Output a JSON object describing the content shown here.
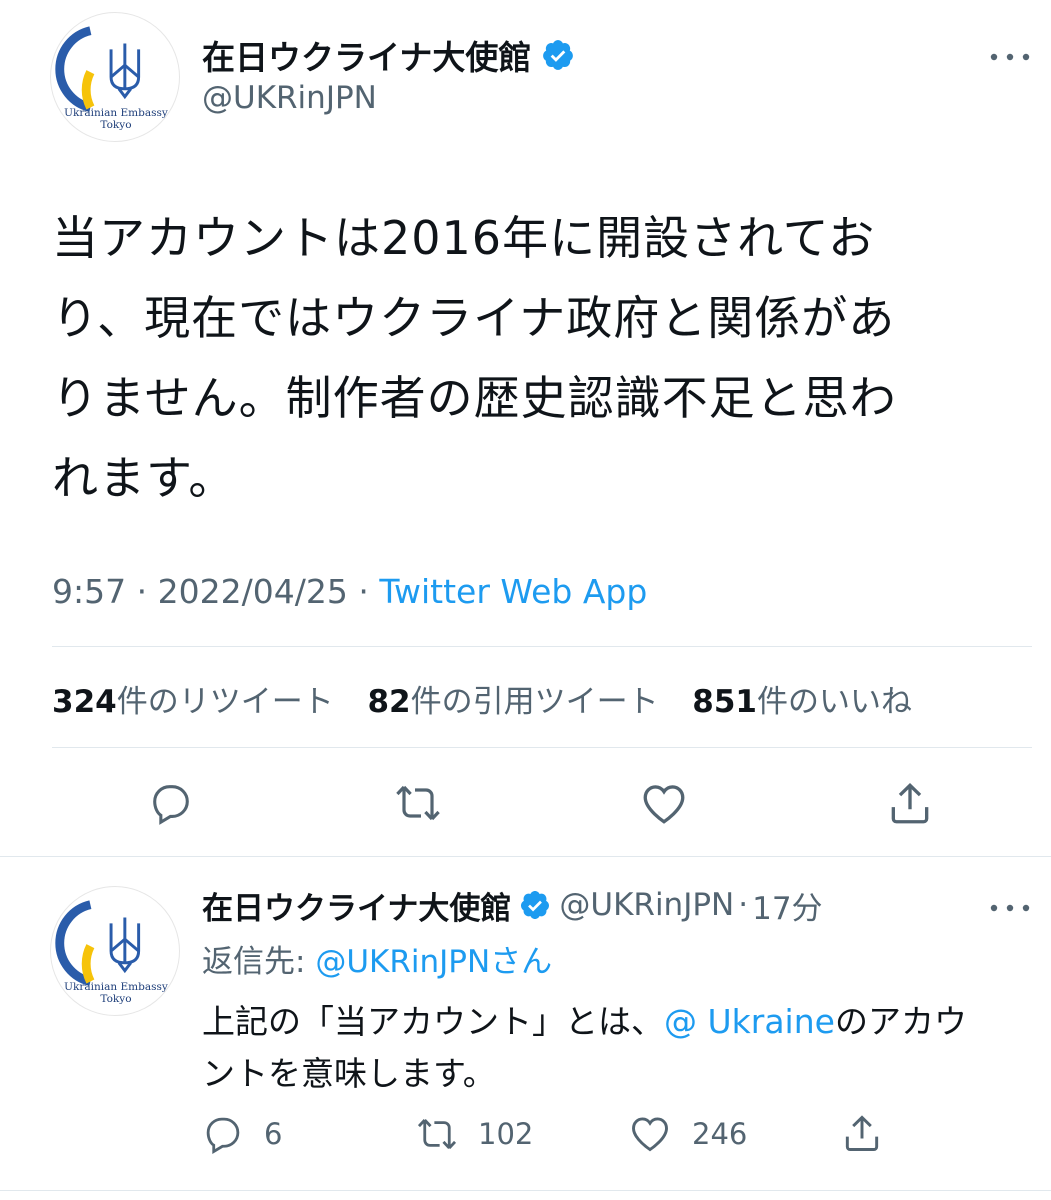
{
  "main_tweet": {
    "author_name": "在日ウクライナ大使館",
    "handle": "@UKRinJPN",
    "avatar_text": [
      "Ukrainian Embassy",
      "Tokyo"
    ],
    "body_lines": [
      "当アカウントは2016年に開設されてお",
      "り、現在ではウクライナ政府と関係があ",
      "りません。制作者の歴史認識不足と思わ",
      "れます。"
    ],
    "time": "9:57",
    "date": "2022/04/25",
    "source": "Twitter Web App",
    "separator": "·",
    "stats": {
      "retweets_count": "324",
      "retweets_label": "件のリツイート",
      "quotes_count": "82",
      "quotes_label": "件の引用ツイート",
      "likes_count": "851",
      "likes_label": "件のいいね"
    }
  },
  "reply_tweet": {
    "author_name": "在日ウクライナ大使館",
    "handle": "@UKRinJPN",
    "separator": "·",
    "time_ago": "17分",
    "avatar_text": [
      "Ukrainian Embassy",
      "Tokyo"
    ],
    "replying_prefix": "返信先:",
    "replying_handle": "@UKRinJPN",
    "replying_suffix": "さん",
    "body_line1_pre": "上記の「当アカウント」とは、",
    "body_mention": "@ Ukraine",
    "body_line1_post": "のアカウ",
    "body_line2": "ントを意味します。",
    "reply_count": "6",
    "retweet_count": "102",
    "like_count": "246"
  },
  "colors": {
    "accent": "#1d9bf0",
    "text": "#0f1419",
    "muted": "#536471",
    "ukraine_blue": "#2a5caa",
    "ukraine_yellow": "#f6c30a"
  }
}
